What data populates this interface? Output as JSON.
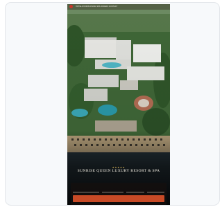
{
  "page": {
    "nav_items": [
      "HOTEL",
      "ROOMS",
      "DINING",
      "SPA",
      "OFFERS",
      "CONTACT"
    ],
    "rating_stars": 5,
    "stars_glyph": "★★★★★",
    "hotel_name": "SUNRISE QUEEN LUXURY RESORT & SPA",
    "tagline": "",
    "booking": {
      "labels": [
        "",
        "",
        "",
        ""
      ],
      "fields": [
        "",
        "",
        "",
        ""
      ],
      "cta_label": ""
    }
  },
  "colors": {
    "accent": "#c84a26",
    "logo": "#c7362a",
    "stars": "#d9b45a",
    "sea": "#2a98a8",
    "vegetation": "#3e6a34",
    "beach": "#c9b48d"
  },
  "icons": {
    "logo": "hotel-logo-icon"
  }
}
